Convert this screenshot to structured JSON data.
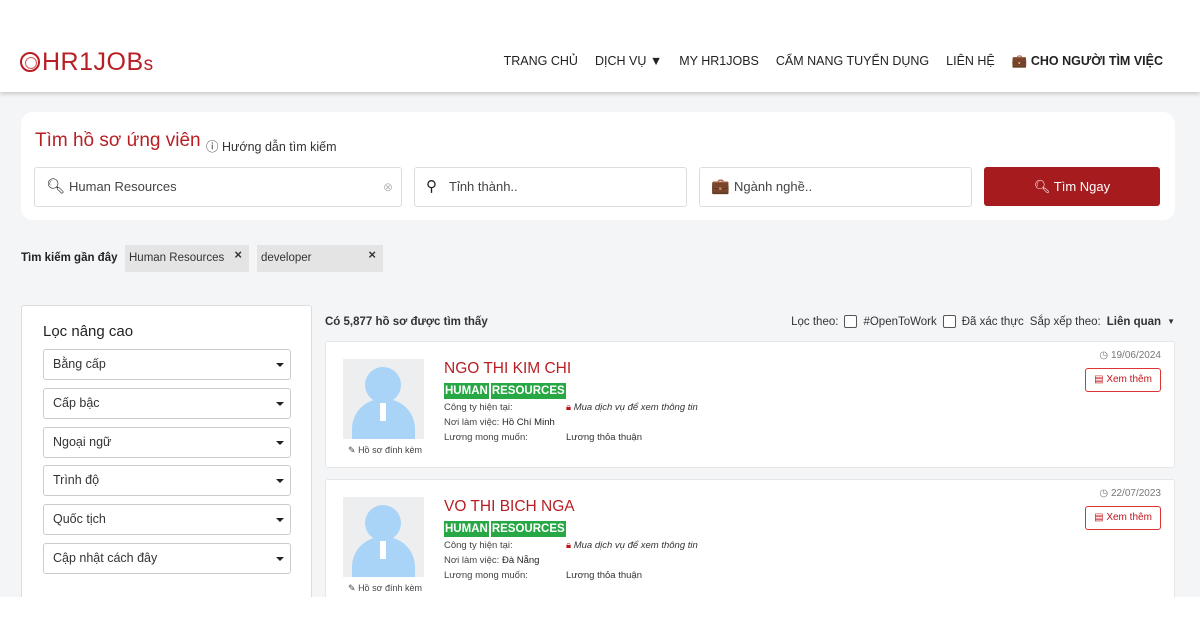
{
  "brand": {
    "logo": "HR1JOB",
    "logo_suffix": "s"
  },
  "nav": [
    "TRANG CHỦ",
    "DỊCH VỤ",
    "MY HR1JOBS",
    "CẨM NANG TUYỂN DỤNG",
    "LIÊN HỆ",
    "CHO NGƯỜI TÌM VIỆC"
  ],
  "search": {
    "title": "Tìm hồ sơ ứng viên",
    "help": "Hướng dẫn tìm kiếm",
    "keyword": "Human Resources",
    "location_placeholder": "Tỉnh thành..",
    "industry_placeholder": "Ngành nghề..",
    "button": "Tìm Ngay"
  },
  "recent": {
    "label": "Tìm kiếm gần đây",
    "tags": [
      "Human Resources",
      "developer"
    ]
  },
  "filter": {
    "title": "Lọc nâng cao",
    "selects": [
      "Bằng cấp",
      "Cấp bậc",
      "Ngoại ngữ",
      "Trình độ",
      "Quốc tịch",
      "Cập nhật cách đây"
    ]
  },
  "results": {
    "count": "Có 5,877 hồ sơ được tìm thấy",
    "filter_label": "Lọc theo:",
    "opt1": "#OpenToWork",
    "opt2": "Đã xác thực",
    "sort_label": "Sắp xếp theo:",
    "sort_value": "Liên quan"
  },
  "labels": {
    "company": "Công ty hiện tại:",
    "locked": "Mua dịch vụ để xem thông tin",
    "location": "Nơi làm việc:",
    "salary": "Lương mong muốn:",
    "attach": "Hồ sơ đính kèm",
    "more": "Xem thêm"
  },
  "candidates": [
    {
      "name": "NGO THI KIM CHI",
      "keywords": [
        "HUMAN",
        "RESOURCES"
      ],
      "location": "Hồ Chí Minh",
      "salary": "Lương thỏa thuận",
      "date": "19/06/2024"
    },
    {
      "name": "VO THI BICH NGA",
      "keywords": [
        "HUMAN",
        "RESOURCES"
      ],
      "location": "Đà Nẵng",
      "salary": "Lương thỏa thuận",
      "date": "22/07/2023"
    }
  ]
}
